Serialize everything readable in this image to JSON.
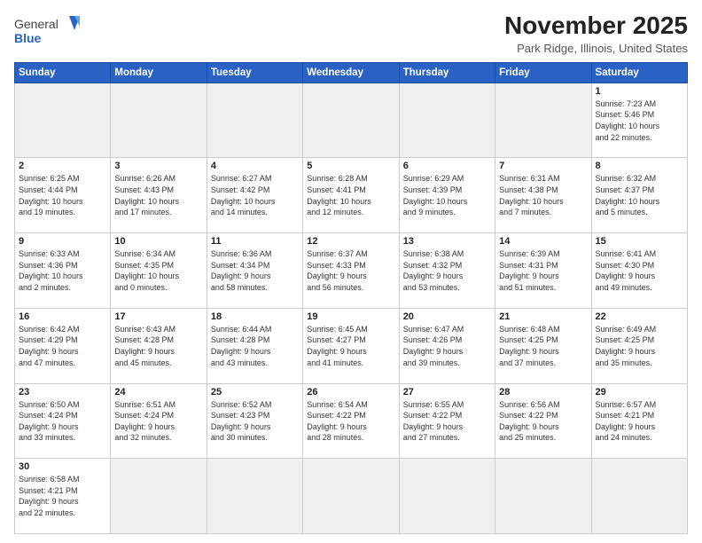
{
  "header": {
    "logo_text_regular": "General",
    "logo_text_bold": "Blue",
    "month_title": "November 2025",
    "subtitle": "Park Ridge, Illinois, United States"
  },
  "weekdays": [
    "Sunday",
    "Monday",
    "Tuesday",
    "Wednesday",
    "Thursday",
    "Friday",
    "Saturday"
  ],
  "weeks": [
    [
      {
        "day": "",
        "info": ""
      },
      {
        "day": "",
        "info": ""
      },
      {
        "day": "",
        "info": ""
      },
      {
        "day": "",
        "info": ""
      },
      {
        "day": "",
        "info": ""
      },
      {
        "day": "",
        "info": ""
      },
      {
        "day": "1",
        "info": "Sunrise: 7:23 AM\nSunset: 5:46 PM\nDaylight: 10 hours\nand 22 minutes."
      }
    ],
    [
      {
        "day": "2",
        "info": "Sunrise: 6:25 AM\nSunset: 4:44 PM\nDaylight: 10 hours\nand 19 minutes."
      },
      {
        "day": "3",
        "info": "Sunrise: 6:26 AM\nSunset: 4:43 PM\nDaylight: 10 hours\nand 17 minutes."
      },
      {
        "day": "4",
        "info": "Sunrise: 6:27 AM\nSunset: 4:42 PM\nDaylight: 10 hours\nand 14 minutes."
      },
      {
        "day": "5",
        "info": "Sunrise: 6:28 AM\nSunset: 4:41 PM\nDaylight: 10 hours\nand 12 minutes."
      },
      {
        "day": "6",
        "info": "Sunrise: 6:29 AM\nSunset: 4:39 PM\nDaylight: 10 hours\nand 9 minutes."
      },
      {
        "day": "7",
        "info": "Sunrise: 6:31 AM\nSunset: 4:38 PM\nDaylight: 10 hours\nand 7 minutes."
      },
      {
        "day": "8",
        "info": "Sunrise: 6:32 AM\nSunset: 4:37 PM\nDaylight: 10 hours\nand 5 minutes."
      }
    ],
    [
      {
        "day": "9",
        "info": "Sunrise: 6:33 AM\nSunset: 4:36 PM\nDaylight: 10 hours\nand 2 minutes."
      },
      {
        "day": "10",
        "info": "Sunrise: 6:34 AM\nSunset: 4:35 PM\nDaylight: 10 hours\nand 0 minutes."
      },
      {
        "day": "11",
        "info": "Sunrise: 6:36 AM\nSunset: 4:34 PM\nDaylight: 9 hours\nand 58 minutes."
      },
      {
        "day": "12",
        "info": "Sunrise: 6:37 AM\nSunset: 4:33 PM\nDaylight: 9 hours\nand 56 minutes."
      },
      {
        "day": "13",
        "info": "Sunrise: 6:38 AM\nSunset: 4:32 PM\nDaylight: 9 hours\nand 53 minutes."
      },
      {
        "day": "14",
        "info": "Sunrise: 6:39 AM\nSunset: 4:31 PM\nDaylight: 9 hours\nand 51 minutes."
      },
      {
        "day": "15",
        "info": "Sunrise: 6:41 AM\nSunset: 4:30 PM\nDaylight: 9 hours\nand 49 minutes."
      }
    ],
    [
      {
        "day": "16",
        "info": "Sunrise: 6:42 AM\nSunset: 4:29 PM\nDaylight: 9 hours\nand 47 minutes."
      },
      {
        "day": "17",
        "info": "Sunrise: 6:43 AM\nSunset: 4:28 PM\nDaylight: 9 hours\nand 45 minutes."
      },
      {
        "day": "18",
        "info": "Sunrise: 6:44 AM\nSunset: 4:28 PM\nDaylight: 9 hours\nand 43 minutes."
      },
      {
        "day": "19",
        "info": "Sunrise: 6:45 AM\nSunset: 4:27 PM\nDaylight: 9 hours\nand 41 minutes."
      },
      {
        "day": "20",
        "info": "Sunrise: 6:47 AM\nSunset: 4:26 PM\nDaylight: 9 hours\nand 39 minutes."
      },
      {
        "day": "21",
        "info": "Sunrise: 6:48 AM\nSunset: 4:25 PM\nDaylight: 9 hours\nand 37 minutes."
      },
      {
        "day": "22",
        "info": "Sunrise: 6:49 AM\nSunset: 4:25 PM\nDaylight: 9 hours\nand 35 minutes."
      }
    ],
    [
      {
        "day": "23",
        "info": "Sunrise: 6:50 AM\nSunset: 4:24 PM\nDaylight: 9 hours\nand 33 minutes."
      },
      {
        "day": "24",
        "info": "Sunrise: 6:51 AM\nSunset: 4:24 PM\nDaylight: 9 hours\nand 32 minutes."
      },
      {
        "day": "25",
        "info": "Sunrise: 6:52 AM\nSunset: 4:23 PM\nDaylight: 9 hours\nand 30 minutes."
      },
      {
        "day": "26",
        "info": "Sunrise: 6:54 AM\nSunset: 4:22 PM\nDaylight: 9 hours\nand 28 minutes."
      },
      {
        "day": "27",
        "info": "Sunrise: 6:55 AM\nSunset: 4:22 PM\nDaylight: 9 hours\nand 27 minutes."
      },
      {
        "day": "28",
        "info": "Sunrise: 6:56 AM\nSunset: 4:22 PM\nDaylight: 9 hours\nand 25 minutes."
      },
      {
        "day": "29",
        "info": "Sunrise: 6:57 AM\nSunset: 4:21 PM\nDaylight: 9 hours\nand 24 minutes."
      }
    ],
    [
      {
        "day": "30",
        "info": "Sunrise: 6:58 AM\nSunset: 4:21 PM\nDaylight: 9 hours\nand 22 minutes."
      },
      {
        "day": "",
        "info": ""
      },
      {
        "day": "",
        "info": ""
      },
      {
        "day": "",
        "info": ""
      },
      {
        "day": "",
        "info": ""
      },
      {
        "day": "",
        "info": ""
      },
      {
        "day": "",
        "info": ""
      }
    ]
  ]
}
